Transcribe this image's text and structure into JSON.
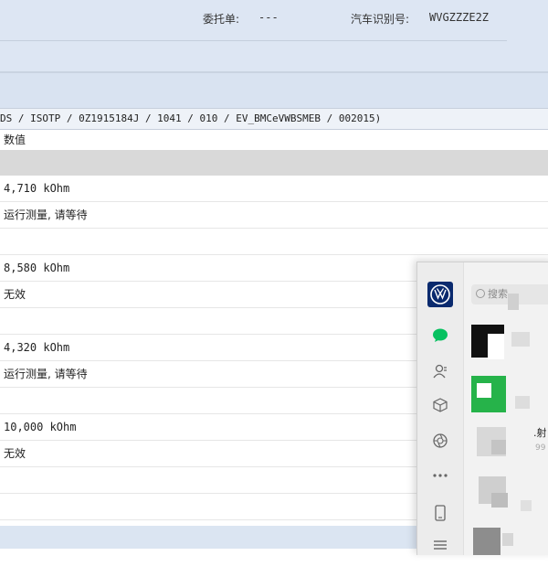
{
  "header": {
    "order_label": "委托单:",
    "order_value": "---",
    "vin_label": "汽车识别号:",
    "vin_value": "WVGZZZE2Z"
  },
  "path": "DS / ISOTP / 0Z1915184J / 1041 / 010 / EV_BMCeVWBSMEB / 002015)",
  "table": {
    "column_header": "数值",
    "rows": [
      "4,710 kOhm",
      "运行测量, 请等待",
      "",
      "8,580 kOhm",
      "无效",
      "",
      "4,320 kOhm",
      "运行测量, 请等待",
      "",
      "10,000 kOhm",
      "无效",
      "",
      ""
    ]
  },
  "chat": {
    "search_placeholder": "搜索",
    "item_text": ".射",
    "item_count": "99",
    "rail_icons": [
      "vw-logo-icon",
      "chat-bubble-icon",
      "contacts-icon",
      "box-icon",
      "aperture-icon",
      "more-icon",
      "phone-icon",
      "menu-icon"
    ]
  }
}
